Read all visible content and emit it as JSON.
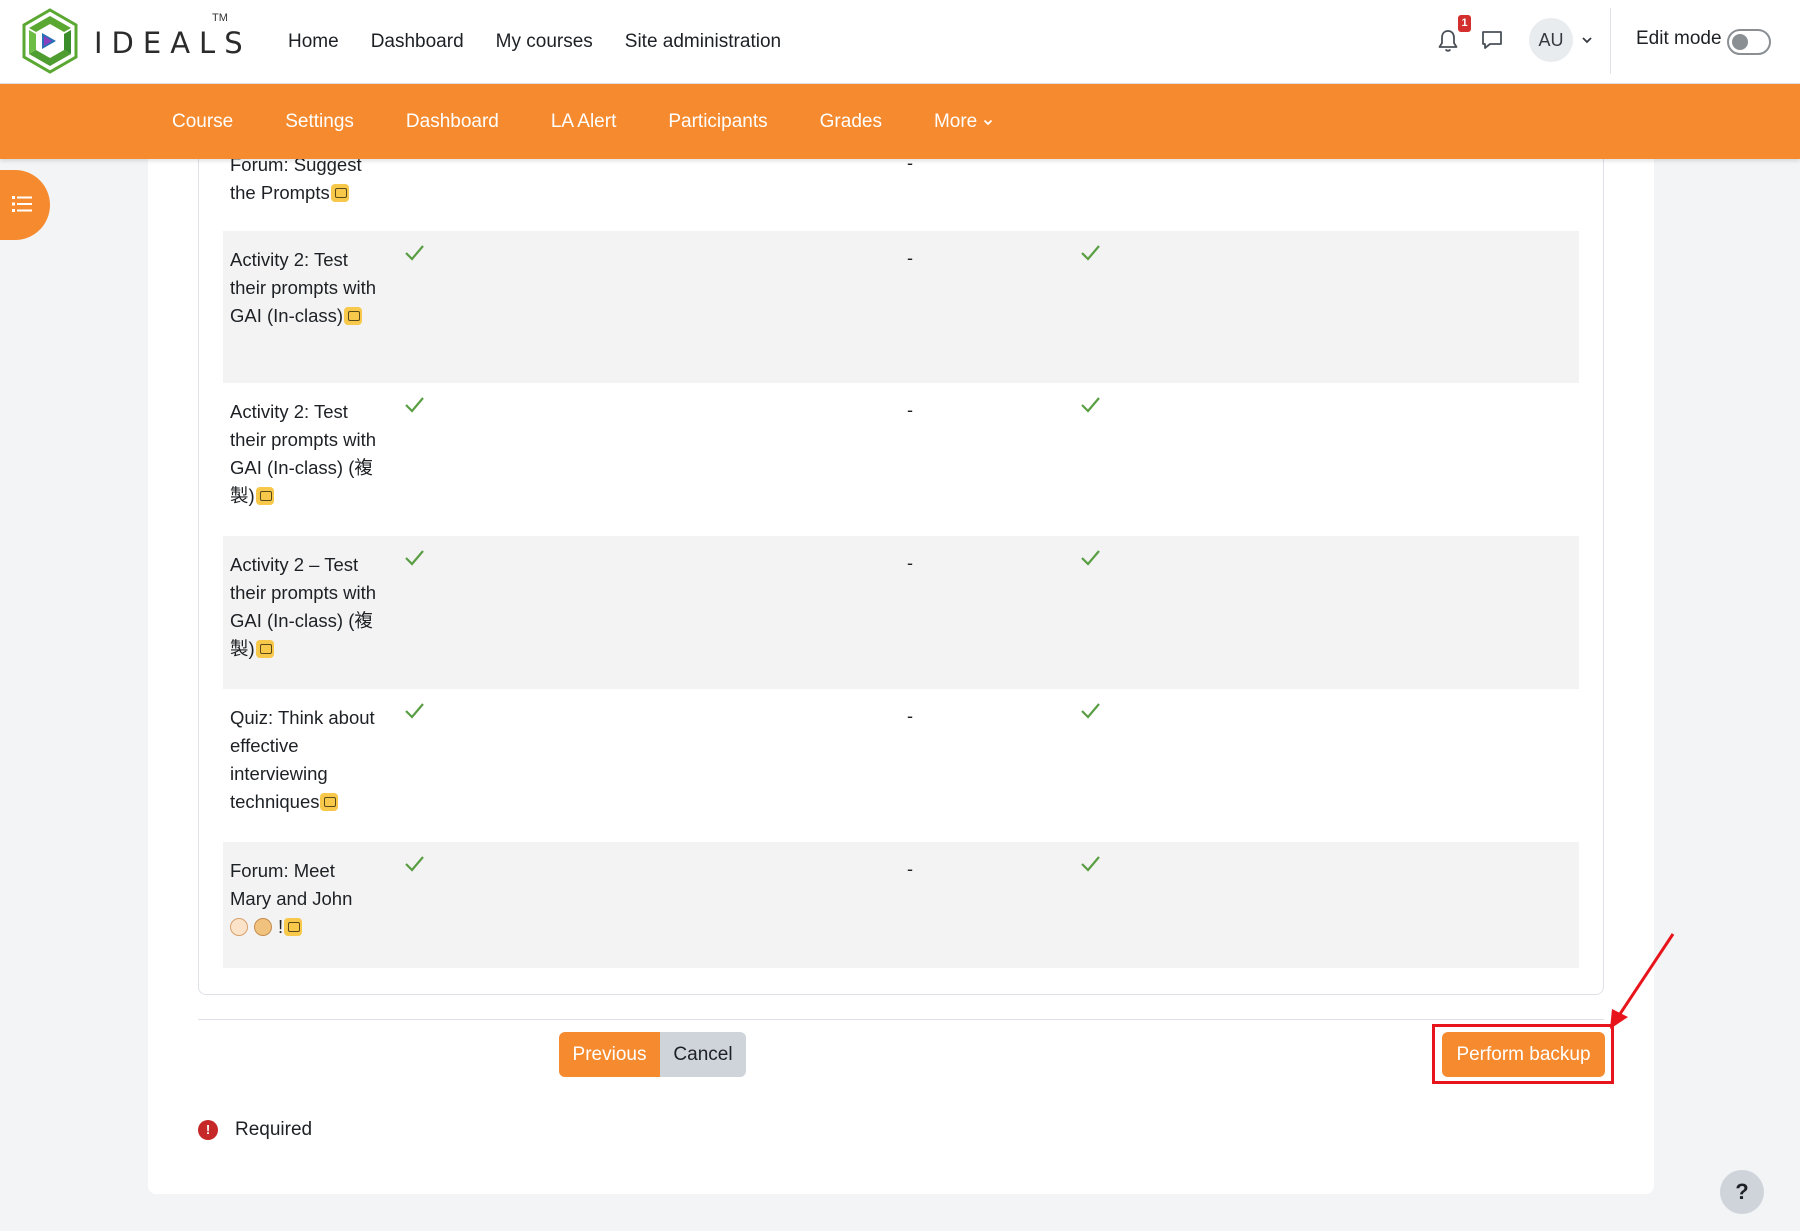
{
  "brand": {
    "name": "IDEALS",
    "tm": "TM"
  },
  "primary_nav": [
    "Home",
    "Dashboard",
    "My courses",
    "Site administration"
  ],
  "notifications": {
    "count": "1"
  },
  "user": {
    "initials": "AU"
  },
  "edit_mode": {
    "label": "Edit mode",
    "enabled": false
  },
  "secondary_nav": [
    "Course",
    "Settings",
    "Dashboard",
    "LA Alert",
    "Participants",
    "Grades",
    "More"
  ],
  "table": {
    "rows": [
      {
        "name": "Forum: Suggest the Prompts",
        "include": true,
        "userdata": "-",
        "userdata2": true
      },
      {
        "name": "Activity 2: Test their prompts with GAI (In-class)",
        "include": true,
        "userdata": "-",
        "userdata2": true
      },
      {
        "name": "Activity 2: Test their prompts with GAI (In-class) (複製)",
        "include": true,
        "userdata": "-",
        "userdata2": true
      },
      {
        "name": "Activity 2 – Test their prompts with GAI (In-class) (複製)",
        "include": true,
        "userdata": "-",
        "userdata2": true
      },
      {
        "name": "Quiz: Think about effective interviewing techniques",
        "include": true,
        "userdata": "-",
        "userdata2": true
      },
      {
        "name": "Forum: Meet Mary and John",
        "name_suffix": "!",
        "include": true,
        "userdata": "-",
        "userdata2": true
      }
    ]
  },
  "buttons": {
    "previous": "Previous",
    "cancel": "Cancel",
    "perform": "Perform backup"
  },
  "required": {
    "icon": "!",
    "label": "Required"
  },
  "help": {
    "label": "?"
  },
  "colors": {
    "accent": "#f58a2e",
    "highlight": "#e8141b",
    "check": "#5a9e44"
  },
  "icons": {
    "bell": "bell-icon",
    "messages": "chat-icon",
    "drawer": "list-icon",
    "check": "check-icon"
  }
}
